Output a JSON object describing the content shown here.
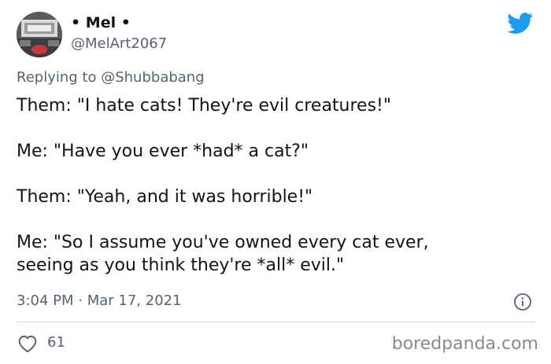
{
  "tweet": {
    "author": {
      "name_prefix": "•",
      "name": "Mel",
      "name_suffix": "•",
      "handle": "@MelArt2067"
    },
    "reply": {
      "label": "Replying to",
      "mention": "@Shubbabang"
    },
    "paragraphs": [
      "Them: \"I hate cats! They're evil creatures!\"",
      "Me: \"Have you ever *had* a cat?\"",
      "Them: \"Yeah, and it was horrible!\"",
      "Me: \"So I assume you've owned every cat ever,\nseeing as you think they're *all* evil.\""
    ],
    "time": "3:04 PM",
    "separator": "·",
    "date": "Mar 17, 2021",
    "likes": "61"
  },
  "icons": {
    "brand": "twitter-bird-icon",
    "info": "info-icon",
    "like": "heart-icon"
  },
  "colors": {
    "twitter_blue": "#1d9bf0",
    "text_primary": "#0f1419",
    "text_secondary": "#536471",
    "divider": "#cfd9de"
  },
  "watermark": "boredpanda.com"
}
